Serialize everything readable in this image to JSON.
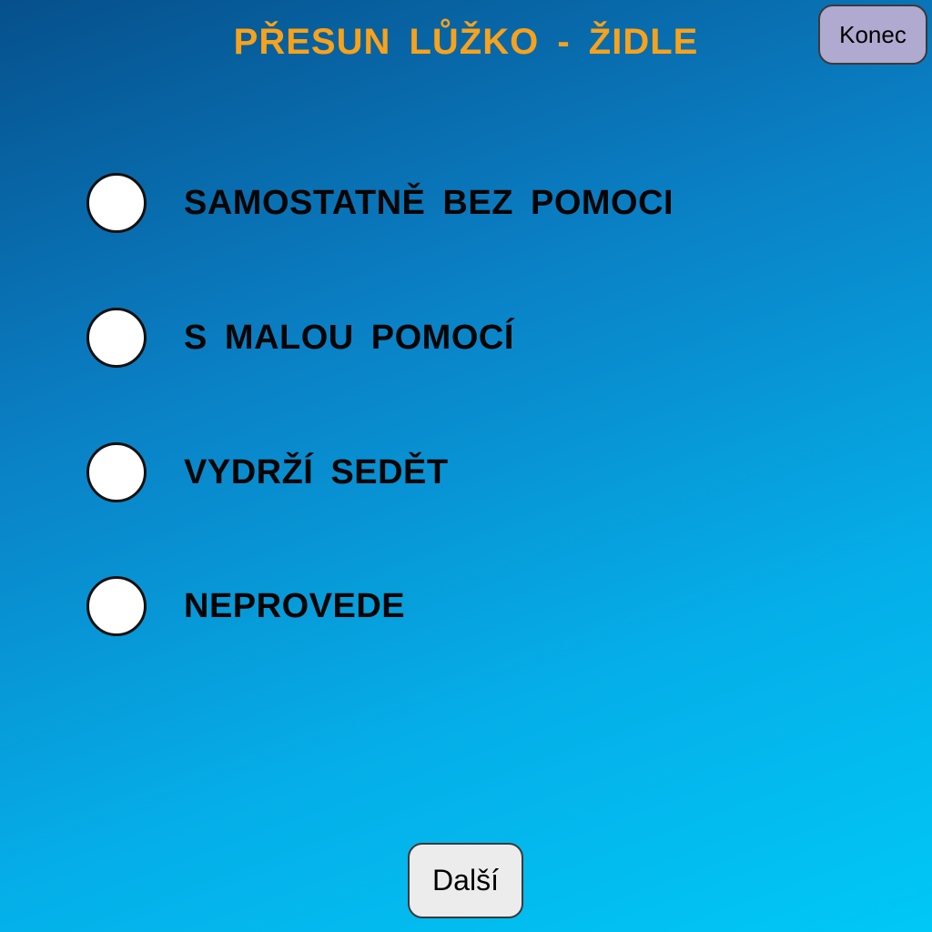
{
  "header": {
    "title": "PŘESUN  LŮŽKO  -  ŽIDLE",
    "end_button_label": "Konec"
  },
  "options": [
    {
      "label": "SAMOSTATNĚ  BEZ  POMOCI",
      "selected": false
    },
    {
      "label": "S  MALOU  POMOCÍ",
      "selected": false
    },
    {
      "label": "VYDRŽÍ  SEDĚT",
      "selected": false
    },
    {
      "label": "NEPROVEDE",
      "selected": false
    }
  ],
  "footer": {
    "next_button_label": "Další"
  },
  "colors": {
    "title": "#f8a21b",
    "background_top": "#06508c",
    "background_bottom": "#00c8f6",
    "end_button_bg": "#b0aad0",
    "next_button_bg": "#ececec"
  }
}
